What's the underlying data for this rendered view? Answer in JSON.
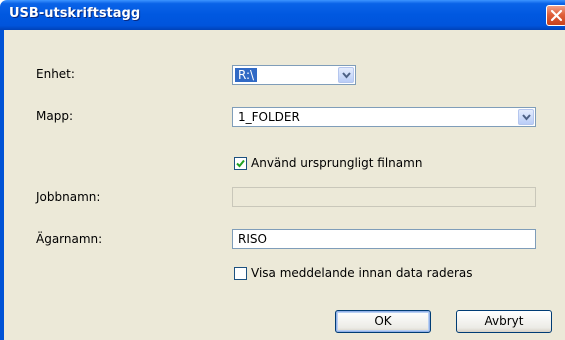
{
  "window": {
    "title": "USB-utskriftstagg"
  },
  "fields": {
    "device": {
      "label": "Enhet:",
      "value": "R:\\"
    },
    "folder": {
      "label": "Mapp:",
      "value": "1_FOLDER"
    },
    "use_original_filename": {
      "label": "Använd ursprungligt filnamn",
      "checked": true
    },
    "job_name": {
      "label": "Jobbnamn:",
      "value": ""
    },
    "owner_name": {
      "label": "Ägarnamn:",
      "value": "RISO"
    },
    "show_message": {
      "label": "Visa meddelande innan data raderas",
      "checked": false
    }
  },
  "buttons": {
    "ok": "OK",
    "cancel": "Avbryt"
  },
  "icons": [
    "close-icon",
    "chevron-down-icon",
    "checkmark-icon"
  ],
  "colors": {
    "titlebar": "#0054dc",
    "dialog_bg": "#ece9d8",
    "selection": "#316ac5",
    "close": "#e0603a"
  }
}
